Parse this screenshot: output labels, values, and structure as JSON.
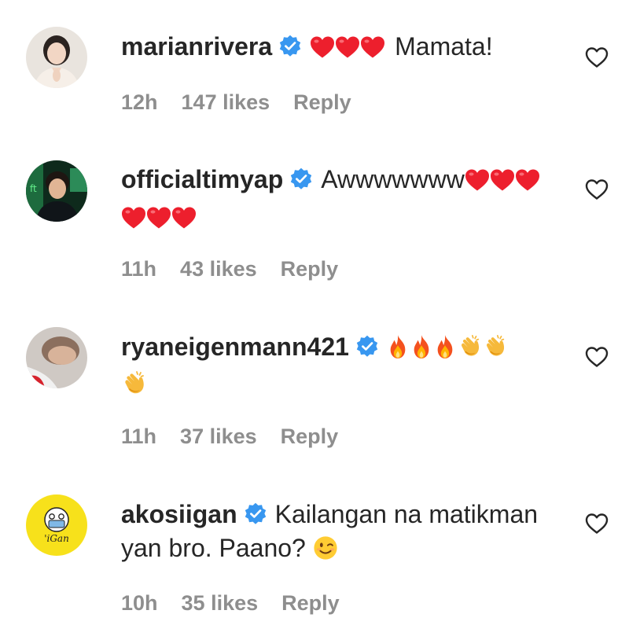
{
  "comments": [
    {
      "username": "marianrivera",
      "text": "Mamata!",
      "emojis_before": "❤️❤️❤️",
      "time": "12h",
      "likes": "147 likes",
      "reply": "Reply"
    },
    {
      "username": "officialtimyap",
      "text": "Awwwwwww",
      "emojis_after": "❤️❤️❤️❤️❤️❤️",
      "time": "11h",
      "likes": "43 likes",
      "reply": "Reply"
    },
    {
      "username": "ryaneigenmann421",
      "emojis_after": "🔥🔥🔥👏👏👏",
      "time": "11h",
      "likes": "37 likes",
      "reply": "Reply"
    },
    {
      "username": "akosiigan",
      "text": "Kailangan na matikman yan bro. Paano?",
      "emojis_after": "😉",
      "avatar_text": "'iGan",
      "time": "10h",
      "likes": "35 likes",
      "reply": "Reply"
    }
  ],
  "icons": {
    "verified": "verified-badge-icon",
    "like": "heart-outline-icon"
  },
  "colors": {
    "text": "#262626",
    "meta": "#8e8e8e",
    "verified": "#3897f0",
    "heart": "#ed1f2d"
  }
}
